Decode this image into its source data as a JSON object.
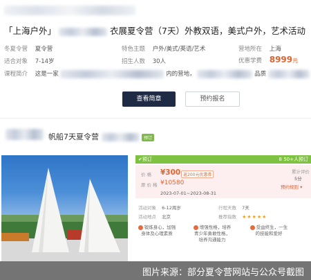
{
  "listing": {
    "title_left": "「上海户外」",
    "title_right": "衣展夏令营（7天）外教双语，美式户外，艺术活动",
    "rows": [
      {
        "k1": "冬夏令营",
        "v1": "夏令营",
        "k2": "特色主题",
        "v2": "户外/美式/英语/艺术",
        "k3": "营地所在",
        "v3": "上海"
      },
      {
        "k1": "适合对象",
        "v1": "7-14岁",
        "k2": "招生人数",
        "v2": "30人",
        "k3": "优惠学费",
        "v3": "8999",
        "unit": "元"
      }
    ],
    "intro_key": "课程简介",
    "intro_start": "这是一家",
    "intro_mid": "内的营地，",
    "intro_end": "品质",
    "btn_view": "查看简章",
    "btn_book": "预约报名"
  },
  "product": {
    "title": "帆船7天夏令营",
    "tag": "预订",
    "bar_left": "✔预订",
    "bar_right": "8 50+人预订",
    "price_label": "价 格",
    "price": "¥300",
    "price_tag": "返200元优惠券",
    "orig_label": "原 价 格",
    "orig_price": "¥10580",
    "dates": "2023-07-01~2023-08-31",
    "sold_label": "累计评价",
    "sold_value": "5分",
    "rules": "预约规则 ▾",
    "meta": [
      {
        "k": "活动对象",
        "v": "6-12周岁",
        "k2": "行程天数",
        "v2": "7天"
      },
      {
        "k": "活动地点",
        "v": "北京",
        "k2": "推荐指数",
        "v2": "★★★★★"
      }
    ],
    "features": [
      "锻炼身心，加强身体及心理素质",
      "增强性格，培养青少年勇敢性格，培养沟通能力",
      "受益终生，一生的技能和爱好"
    ]
  },
  "footer": "图片来源：部分夏令营网站与公众号截图"
}
